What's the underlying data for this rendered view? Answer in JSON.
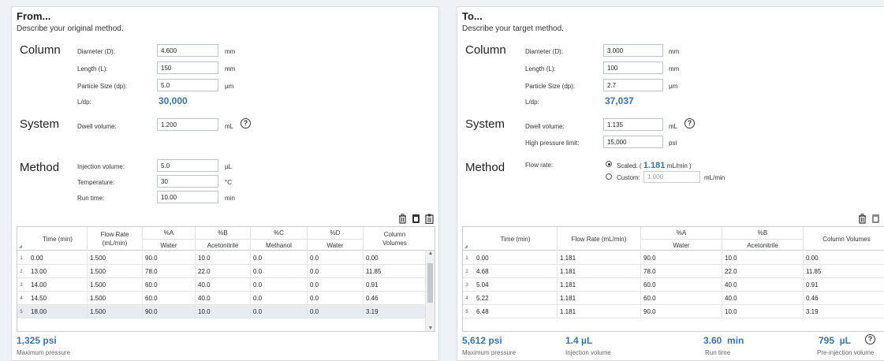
{
  "from": {
    "title": "From...",
    "description": "Describe your original method.",
    "column": {
      "section_label": "Column",
      "diameter_label": "Diameter (D):",
      "diameter": "4.600",
      "diameter_unit": "mm",
      "length_label": "Length (L):",
      "length": "150",
      "length_unit": "mm",
      "particle_label": "Particle Size (dp):",
      "particle": "5.0",
      "particle_unit": "µm",
      "ldp_label": "L/dp:",
      "ldp": "30,000"
    },
    "system": {
      "section_label": "System",
      "dwell_label": "Dwell volume:",
      "dwell": "1.200",
      "dwell_unit": "mL"
    },
    "method": {
      "section_label": "Method",
      "injection_label": "Injection volume:",
      "injection": "5.0",
      "injection_unit": "µL",
      "temperature_label": "Temperature:",
      "temperature": "30",
      "temperature_unit": "°C",
      "runtime_label": "Run time:",
      "runtime": "10.00",
      "runtime_unit": "min"
    },
    "table": {
      "headers": {
        "time": "Time (min)",
        "flow_1": "Flow Rate",
        "flow_2": "(mL/min)",
        "a_1": "%A",
        "a_2": "Water",
        "b_1": "%B",
        "b_2": "Acetonitrile",
        "c_1": "%C",
        "c_2": "Methanol",
        "d_1": "%D",
        "d_2": "Water",
        "cv_1": "Column",
        "cv_2": "Volumes"
      },
      "rows": [
        {
          "n": "1",
          "time": "0.00",
          "flow": "1.500",
          "a": "90.0",
          "b": "10.0",
          "c": "0.0",
          "d": "0.0",
          "cv": "0.00"
        },
        {
          "n": "2",
          "time": "13.00",
          "flow": "1.500",
          "a": "78.0",
          "b": "22.0",
          "c": "0.0",
          "d": "0.0",
          "cv": "11.85"
        },
        {
          "n": "3",
          "time": "14.00",
          "flow": "1.500",
          "a": "60.0",
          "b": "40.0",
          "c": "0.0",
          "d": "0.0",
          "cv": "0.91"
        },
        {
          "n": "4",
          "time": "14.50",
          "flow": "1.500",
          "a": "60.0",
          "b": "40.0",
          "c": "0.0",
          "d": "0.0",
          "cv": "0.46"
        },
        {
          "n": "5",
          "time": "18.00",
          "flow": "1.500",
          "a": "90.0",
          "b": "10.0",
          "c": "0.0",
          "d": "0.0",
          "cv": "3.19"
        }
      ]
    },
    "footer": {
      "pressure_value": "1,325 psi",
      "pressure_label": "Maximum pressure"
    },
    "toolbar_icons": [
      "delete-icon",
      "paste-icon",
      "clipboard-icon"
    ]
  },
  "to": {
    "title": "To...",
    "description": "Describe your target method.",
    "column": {
      "section_label": "Column",
      "diameter_label": "Diameter (D):",
      "diameter": "3.000",
      "diameter_unit": "mm",
      "length_label": "Length (L):",
      "length": "100",
      "length_unit": "mm",
      "particle_label": "Particle Size (dp):",
      "particle": "2.7",
      "particle_unit": "µm",
      "ldp_label": "L/dp:",
      "ldp": "37,037"
    },
    "system": {
      "section_label": "System",
      "dwell_label": "Dwell volume:",
      "dwell": "1.135",
      "dwell_unit": "mL",
      "hpl_label": "High pressure limit:",
      "hpl": "15,000",
      "hpl_unit": "psi"
    },
    "method": {
      "section_label": "Method",
      "flow_label": "Flow rate:",
      "scaled_prefix": "Scaled: (",
      "scaled_value": "1.181",
      "scaled_suffix": "mL/min )",
      "custom_label": "Custom:",
      "custom_value": "1.000",
      "custom_unit": "mL/min",
      "selected": "scaled"
    },
    "table": {
      "headers": {
        "time": "Time (min)",
        "flow": "Flow Rate (mL/min)",
        "a_1": "%A",
        "a_2": "Water",
        "b_1": "%B",
        "b_2": "Acetonitrile",
        "cv": "Column Volumes"
      },
      "rows": [
        {
          "n": "1",
          "time": "0.00",
          "flow": "1.181",
          "a": "90.0",
          "b": "10.0",
          "cv": "0.00"
        },
        {
          "n": "2",
          "time": "4.68",
          "flow": "1.181",
          "a": "78.0",
          "b": "22.0",
          "cv": "11.85"
        },
        {
          "n": "3",
          "time": "5.04",
          "flow": "1.181",
          "a": "60.0",
          "b": "40.0",
          "cv": "0.91"
        },
        {
          "n": "4",
          "time": "5.22",
          "flow": "1.181",
          "a": "60.0",
          "b": "40.0",
          "cv": "0.46"
        },
        {
          "n": "5",
          "time": "6.48",
          "flow": "1.181",
          "a": "90.0",
          "b": "10.0",
          "cv": "3.19"
        }
      ]
    },
    "footer": {
      "pressure_value": "5,612 psi",
      "pressure_label": "Maximum pressure",
      "injection_value": "1.4",
      "injection_unit": "µL",
      "injection_label": "Injection volume",
      "runtime_value": "3.60",
      "runtime_unit": "min",
      "runtime_label": "Run time",
      "preinj_value": "795",
      "preinj_unit": "µL",
      "preinj_label": "Pre-injection volume"
    },
    "toolbar_icons": [
      "delete-icon",
      "paste-icon",
      "export-icon"
    ]
  },
  "help_glyph": "?",
  "colors": {
    "accent": "#3d73a4",
    "panel_bg": "#ffffff",
    "page_bg": "#eef1f4"
  }
}
